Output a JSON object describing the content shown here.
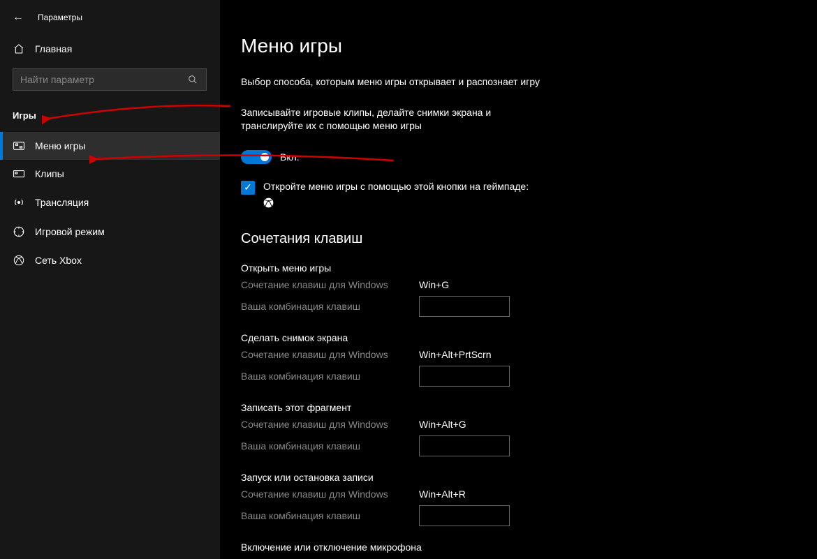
{
  "header": {
    "title": "Параметры"
  },
  "sidebar": {
    "home": "Главная",
    "search_placeholder": "Найти параметр",
    "section": "Игры",
    "items": [
      {
        "label": "Меню игры"
      },
      {
        "label": "Клипы"
      },
      {
        "label": "Трансляция"
      },
      {
        "label": "Игровой режим"
      },
      {
        "label": "Сеть Xbox"
      }
    ]
  },
  "main": {
    "title": "Меню игры",
    "desc1": "Выбор способа, которым меню игры открывает и распознает игру",
    "desc2": "Записывайте игровые клипы, делайте снимки экрана и транслируйте их с помощью меню игры",
    "toggle_label": "Вкл.",
    "checkbox_label": "Откройте меню игры с помощью этой кнопки на геймпаде:",
    "shortcuts_heading": "Сочетания клавиш",
    "win_label": "Сочетание клавиш для Windows",
    "custom_label": "Ваша комбинация клавиш",
    "shortcuts": [
      {
        "title": "Открыть меню игры",
        "value": "Win+G"
      },
      {
        "title": "Сделать снимок экрана",
        "value": "Win+Alt+PrtScrn"
      },
      {
        "title": "Записать этот фрагмент",
        "value": "Win+Alt+G"
      },
      {
        "title": "Запуск или остановка записи",
        "value": "Win+Alt+R"
      }
    ],
    "mic_heading": "Включение или отключение микрофона"
  }
}
